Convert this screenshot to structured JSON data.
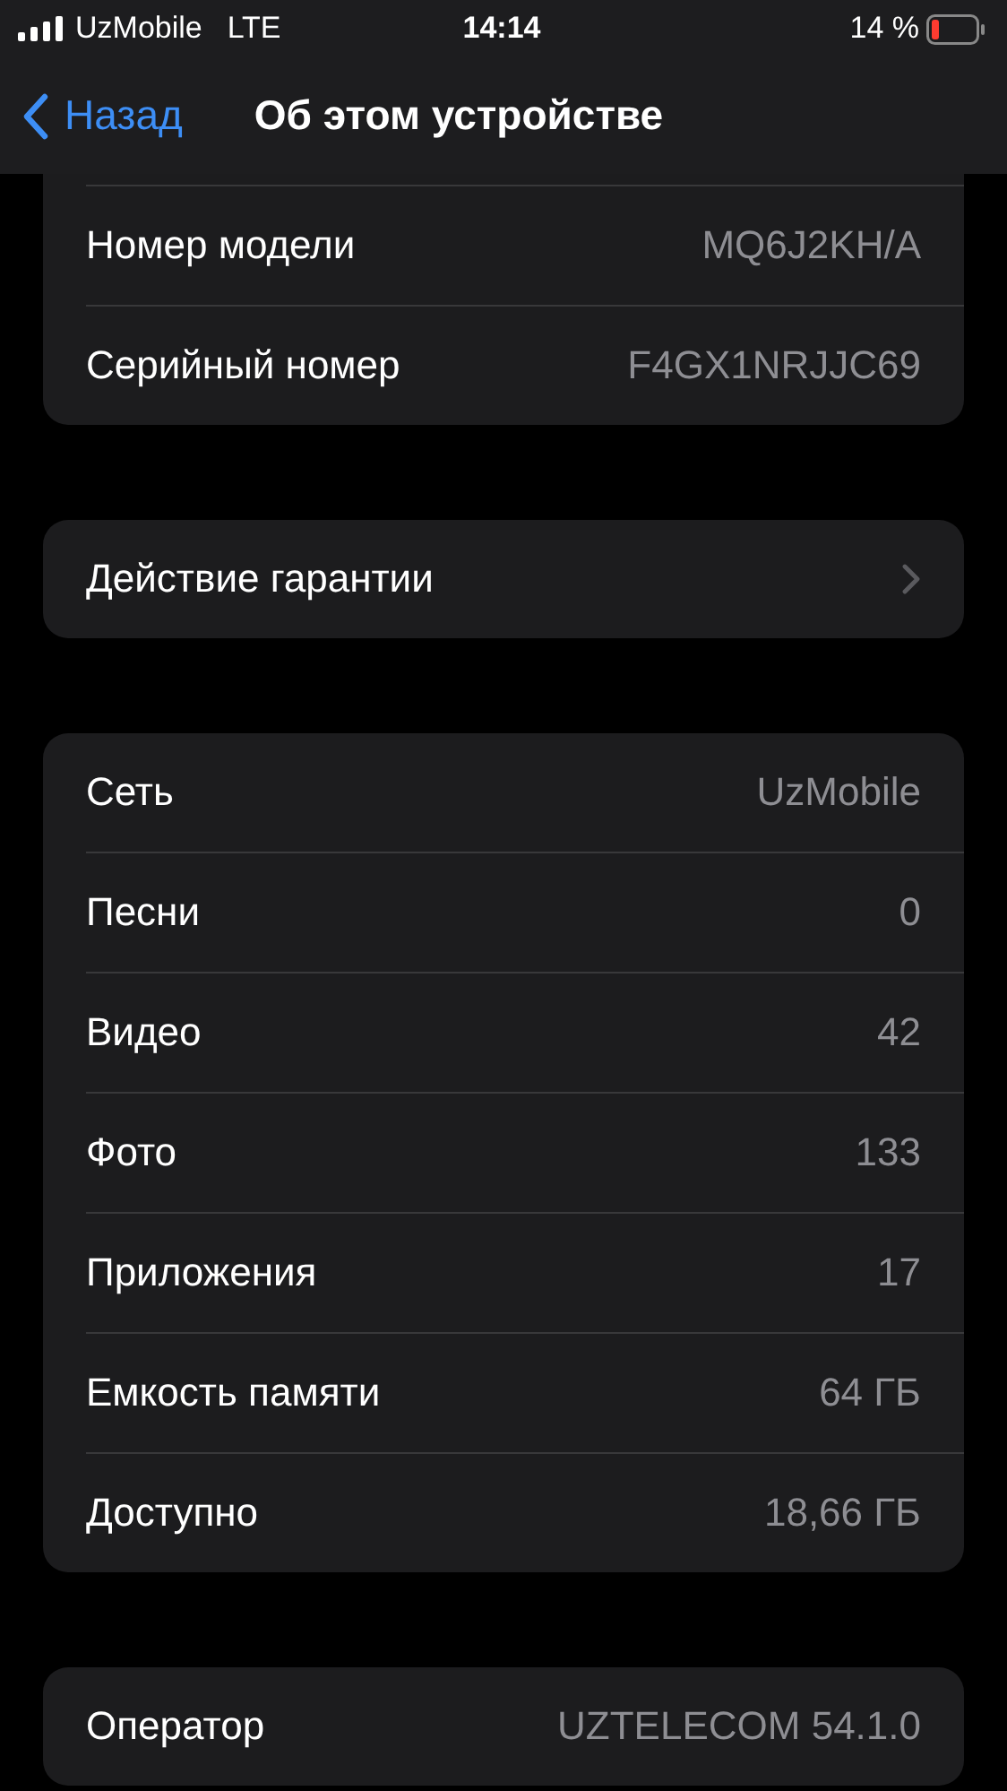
{
  "status_bar": {
    "carrier": "UzMobile",
    "network": "LTE",
    "time": "14:14",
    "battery": "14 %"
  },
  "nav": {
    "back": "Назад",
    "title": "Об этом устройстве"
  },
  "sections": [
    {
      "cut_top": true,
      "rows": [
        {
          "kind": "info",
          "label": "Номер модели",
          "value": "MQ6J2KH/A"
        },
        {
          "kind": "info",
          "label": "Серийный номер",
          "value": "F4GX1NRJJC69"
        }
      ]
    },
    {
      "rows": [
        {
          "kind": "link",
          "label": "Действие гарантии"
        }
      ]
    },
    {
      "rows": [
        {
          "kind": "info",
          "label": "Сеть",
          "value": "UzMobile"
        },
        {
          "kind": "info",
          "label": "Песни",
          "value": "0"
        },
        {
          "kind": "info",
          "label": "Видео",
          "value": "42"
        },
        {
          "kind": "info",
          "label": "Фото",
          "value": "133"
        },
        {
          "kind": "info",
          "label": "Приложения",
          "value": "17"
        },
        {
          "kind": "info",
          "label": "Емкость памяти",
          "value": "64 ГБ"
        },
        {
          "kind": "info",
          "label": "Доступно",
          "value": "18,66 ГБ"
        }
      ]
    },
    {
      "rows": [
        {
          "kind": "info",
          "label": "Оператор",
          "value": "UZTELECOM 54.1.0"
        }
      ]
    }
  ]
}
